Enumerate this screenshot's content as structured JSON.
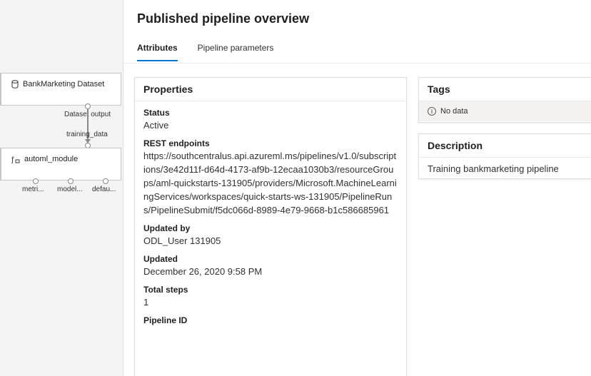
{
  "canvas": {
    "dataset_node": {
      "title": "BankMarketing Dataset",
      "output_label": "Dataset output"
    },
    "edge_label": "training_data",
    "automl_node": {
      "title": "automl_module",
      "ports": [
        "metri...",
        "model...",
        "defau..."
      ]
    }
  },
  "panel": {
    "title": "Published pipeline overview",
    "tabs": [
      {
        "label": "Attributes",
        "active": true
      },
      {
        "label": "Pipeline parameters",
        "active": false
      }
    ],
    "properties": {
      "header": "Properties",
      "items": [
        {
          "label": "Status",
          "value": "Active"
        },
        {
          "label": "REST endpoints",
          "value": "https://southcentralus.api.azureml.ms/pipelines/v1.0/subscriptions/3e42d11f-d64d-4173-af9b-12ecaa1030b3/resourceGroups/aml-quickstarts-131905/providers/Microsoft.MachineLearningServices/workspaces/quick-starts-ws-131905/PipelineRuns/PipelineSubmit/f5dc066d-8989-4e79-9668-b1c586685961"
        },
        {
          "label": "Updated by",
          "value": "ODL_User 131905"
        },
        {
          "label": "Updated",
          "value": "December 26, 2020 9:58 PM"
        },
        {
          "label": "Total steps",
          "value": "1"
        },
        {
          "label": "Pipeline ID",
          "value": ""
        }
      ]
    },
    "tags": {
      "header": "Tags",
      "empty_text": "No data"
    },
    "description": {
      "header": "Description",
      "text": "Training bankmarketing pipeline"
    }
  },
  "colors": {
    "accent": "#0078d4",
    "canvas_bg": "#f4f4f4"
  }
}
